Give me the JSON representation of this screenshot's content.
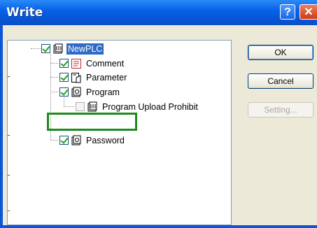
{
  "window": {
    "title": "Write"
  },
  "titlebar": {
    "help_label": "?",
    "close_label": "✕"
  },
  "tree": {
    "root": {
      "label": "NewPLC",
      "checked": true,
      "icon": "plc-icon"
    },
    "items": [
      {
        "label": "Comment",
        "checked": true,
        "icon": "comment-icon"
      },
      {
        "label": "Parameter",
        "checked": true,
        "icon": "parameter-icon"
      },
      {
        "label": "Program",
        "checked": true,
        "icon": "program-icon"
      },
      {
        "label": "Program Upload Prohibit",
        "checked": false,
        "icon": "upload-prohibit-icon"
      },
      {
        "label": "Password",
        "checked": true,
        "icon": "password-icon"
      }
    ]
  },
  "buttons": {
    "ok": "OK",
    "cancel": "Cancel",
    "setting": "Setting..."
  },
  "colors": {
    "titlebar": "#0456d6",
    "selection": "#316ac5",
    "highlight_box": "#1e8a1e",
    "client_bg": "#ece9d8"
  }
}
